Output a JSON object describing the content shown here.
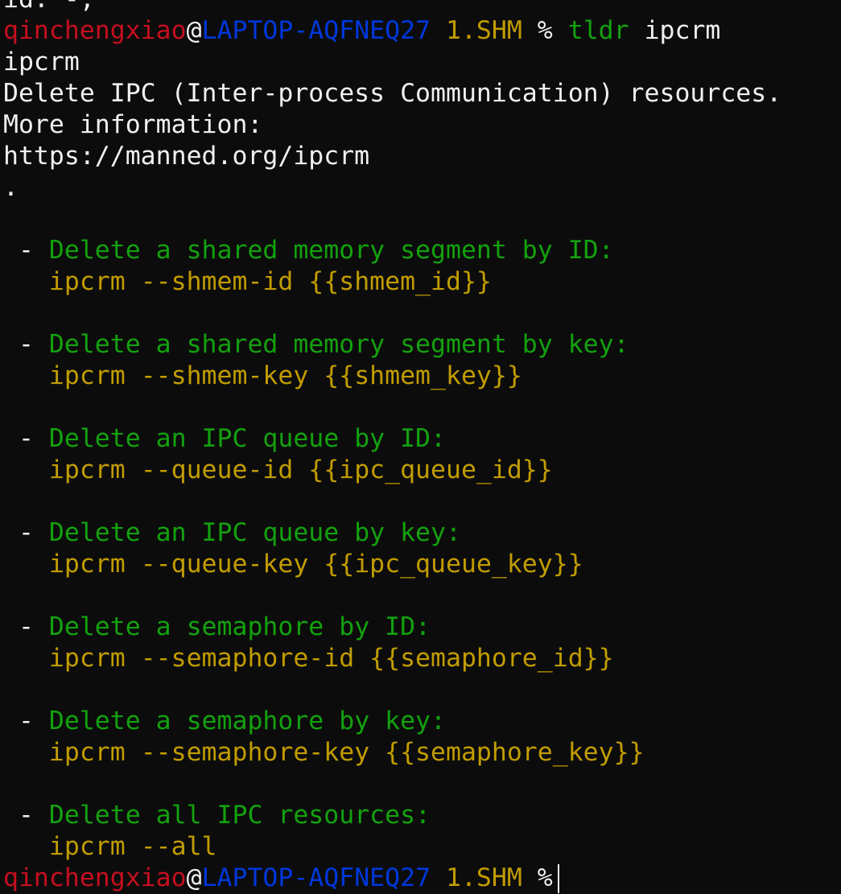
{
  "partial_top_line": "id: -,",
  "prompt": {
    "user": "qinchengxiao",
    "at": "@",
    "host": "LAPTOP-AQFNEQ27",
    "cwd": "1.SHM",
    "symbol": "%"
  },
  "command": {
    "name": "tldr",
    "arg": "ipcrm"
  },
  "page": {
    "title": "ipcrm",
    "description": "Delete IPC (Inter-process Communication) resources.",
    "more_info": "More information:",
    "url": "https://manned.org/ipcrm",
    "trailing_dot": "."
  },
  "examples": [
    {
      "bullet": "-",
      "description": "Delete a shared memory segment by ID:",
      "code": "ipcrm --shmem-id {{shmem_id}}"
    },
    {
      "bullet": "-",
      "description": "Delete a shared memory segment by key:",
      "code": "ipcrm --shmem-key {{shmem_key}}"
    },
    {
      "bullet": "-",
      "description": "Delete an IPC queue by ID:",
      "code": "ipcrm --queue-id {{ipc_queue_id}}"
    },
    {
      "bullet": "-",
      "description": "Delete an IPC queue by key:",
      "code": "ipcrm --queue-key {{ipc_queue_key}}"
    },
    {
      "bullet": "-",
      "description": "Delete a semaphore by ID:",
      "code": "ipcrm --semaphore-id {{semaphore_id}}"
    },
    {
      "bullet": "-",
      "description": "Delete a semaphore by key:",
      "code": "ipcrm --semaphore-key {{semaphore_key}}"
    },
    {
      "bullet": "-",
      "description": "Delete all IPC resources:",
      "code": "ipcrm --all"
    }
  ],
  "colors": {
    "background": "#0c0c0c",
    "foreground": "#f0f0f0",
    "user": "#c50f1f",
    "host": "#0037da",
    "cwd": "#c19c00",
    "description": "#13a10e",
    "code": "#c19c00"
  }
}
